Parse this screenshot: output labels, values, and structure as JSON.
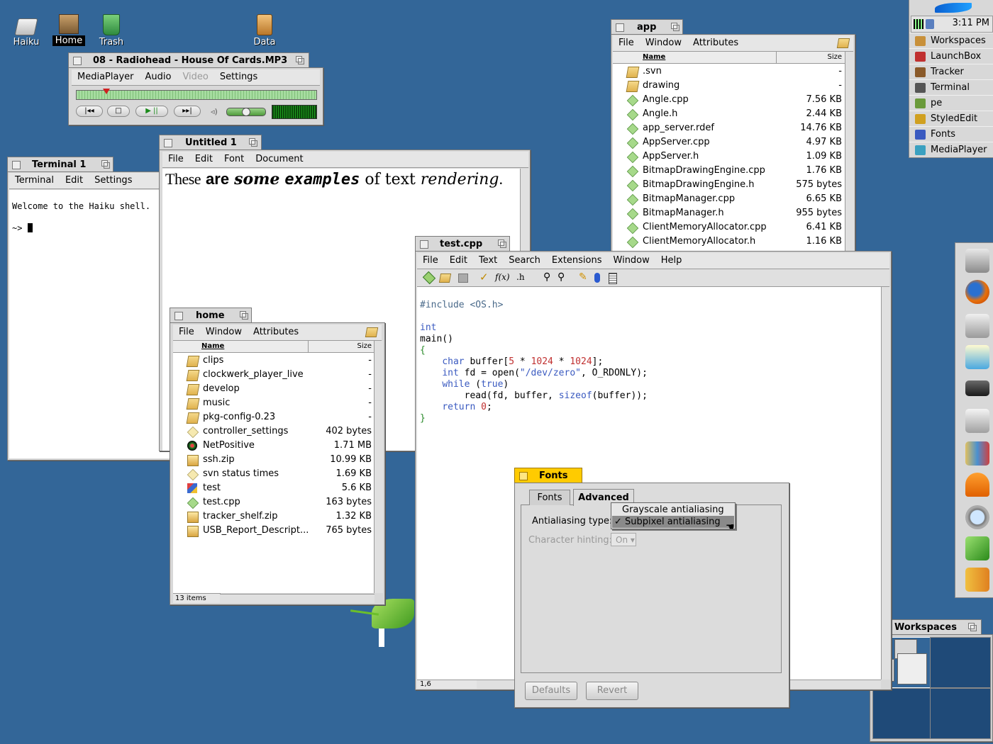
{
  "desktop": {
    "icons": [
      {
        "label": "Haiku"
      },
      {
        "label": "Home"
      },
      {
        "label": "Trash"
      },
      {
        "label": "Data"
      }
    ]
  },
  "deskbar": {
    "clock": "3:11 PM",
    "items": [
      {
        "label": "Workspaces",
        "icon": "workspaces-icon"
      },
      {
        "label": "LaunchBox",
        "icon": "launchbox-icon"
      },
      {
        "label": "Tracker",
        "icon": "tracker-icon"
      },
      {
        "label": "Terminal",
        "icon": "terminal-icon"
      },
      {
        "label": "pe",
        "icon": "pe-icon"
      },
      {
        "label": "StyledEdit",
        "icon": "stylededit-icon"
      },
      {
        "label": "Fonts",
        "icon": "fonts-icon"
      },
      {
        "label": "MediaPlayer",
        "icon": "mediaplayer-icon"
      }
    ]
  },
  "mediaplayer": {
    "title": "08 - Radiohead - House Of Cards.MP3",
    "menu": [
      "MediaPlayer",
      "Audio",
      "Video",
      "Settings"
    ],
    "progress": 0.11,
    "volume": 0.5
  },
  "terminal": {
    "title": "Terminal 1",
    "menu": [
      "Terminal",
      "Edit",
      "Settings"
    ],
    "line1": "Welcome to the Haiku shell.",
    "prompt": "~>"
  },
  "styled": {
    "title": "Untitled 1",
    "menu": [
      "File",
      "Edit",
      "Font",
      "Document"
    ],
    "w1": "These",
    "w2": "are",
    "w3": "some",
    "w4": "examples",
    "w5": "of text",
    "w6": "rendering",
    "w7": "."
  },
  "app_folder": {
    "title": "app",
    "menu": [
      "File",
      "Window",
      "Attributes"
    ],
    "col_name": "Name",
    "col_size": "Size",
    "rows": [
      {
        "name": ".svn",
        "size": "-",
        "kind": "folder"
      },
      {
        "name": "drawing",
        "size": "-",
        "kind": "folder"
      },
      {
        "name": "Angle.cpp",
        "size": "7.56 KB",
        "kind": "source"
      },
      {
        "name": "Angle.h",
        "size": "2.44 KB",
        "kind": "source"
      },
      {
        "name": "app_server.rdef",
        "size": "14.76 KB",
        "kind": "source"
      },
      {
        "name": "AppServer.cpp",
        "size": "4.97 KB",
        "kind": "source"
      },
      {
        "name": "AppServer.h",
        "size": "1.09 KB",
        "kind": "source"
      },
      {
        "name": "BitmapDrawingEngine.cpp",
        "size": "1.76 KB",
        "kind": "source"
      },
      {
        "name": "BitmapDrawingEngine.h",
        "size": "575 bytes",
        "kind": "source"
      },
      {
        "name": "BitmapManager.cpp",
        "size": "6.65 KB",
        "kind": "source"
      },
      {
        "name": "BitmapManager.h",
        "size": "955 bytes",
        "kind": "source"
      },
      {
        "name": "ClientMemoryAllocator.cpp",
        "size": "6.41 KB",
        "kind": "source"
      },
      {
        "name": "ClientMemoryAllocator.h",
        "size": "1.16 KB",
        "kind": "source"
      }
    ]
  },
  "home_folder": {
    "title": "home",
    "menu": [
      "File",
      "Window",
      "Attributes"
    ],
    "col_name": "Name",
    "col_size": "Size",
    "status": "13 items",
    "rows": [
      {
        "name": "clips",
        "size": "-",
        "kind": "folder"
      },
      {
        "name": "clockwerk_player_live",
        "size": "-",
        "kind": "folder"
      },
      {
        "name": "develop",
        "size": "-",
        "kind": "folder"
      },
      {
        "name": "music",
        "size": "-",
        "kind": "folder"
      },
      {
        "name": "pkg-config-0.23",
        "size": "-",
        "kind": "folder"
      },
      {
        "name": "controller_settings",
        "size": "402 bytes",
        "kind": "settings"
      },
      {
        "name": "NetPositive",
        "size": "1.71 MB",
        "kind": "app"
      },
      {
        "name": "ssh.zip",
        "size": "10.99 KB",
        "kind": "zip"
      },
      {
        "name": "svn status times",
        "size": "1.69 KB",
        "kind": "settings"
      },
      {
        "name": "test",
        "size": "5.6 KB",
        "kind": "exec"
      },
      {
        "name": "test.cpp",
        "size": "163 bytes",
        "kind": "source"
      },
      {
        "name": "tracker_shelf.zip",
        "size": "1.32 KB",
        "kind": "zip"
      },
      {
        "name": "USB_Report_Descript...",
        "size": "765 bytes",
        "kind": "zip"
      }
    ]
  },
  "pe": {
    "title": "test.cpp",
    "menu": [
      "File",
      "Edit",
      "Text",
      "Search",
      "Extensions",
      "Window",
      "Help"
    ],
    "toolbar_fx": "f(x)",
    "toolbar_h": ".h",
    "position": "1,6",
    "code": {
      "l1a": "#include ",
      "l1b": "<OS.h>",
      "l3": "int",
      "l4": "main()",
      "l5": "{",
      "l6a": "char",
      "l6b": " buffer[",
      "l6c": "5",
      "l6d": " * ",
      "l6e": "1024",
      "l6f": " * ",
      "l6g": "1024",
      "l6h": "];",
      "l7a": "int",
      "l7b": " fd = open(",
      "l7c": "\"/dev/zero\"",
      "l7d": ", O_RDONLY);",
      "l8a": "while",
      "l8b": " (",
      "l8c": "true",
      "l8d": ")",
      "l9a": "read(fd, buffer, ",
      "l9b": "sizeof",
      "l9c": "(buffer));",
      "l10a": "return",
      "l10b": " ",
      "l10c": "0",
      "l10d": ";",
      "l11": "}"
    }
  },
  "fonts": {
    "title": "Fonts",
    "tabs": [
      "Fonts",
      "Advanced"
    ],
    "aa_label": "Antialiasing type:",
    "aa_options": [
      "Grayscale antialiasing",
      "Subpixel antialiasing"
    ],
    "check": "✓",
    "hint_label": "Character hinting:",
    "hint_value": "On",
    "defaults": "Defaults",
    "revert": "Revert"
  },
  "workspaces": {
    "title": "Workspaces"
  }
}
